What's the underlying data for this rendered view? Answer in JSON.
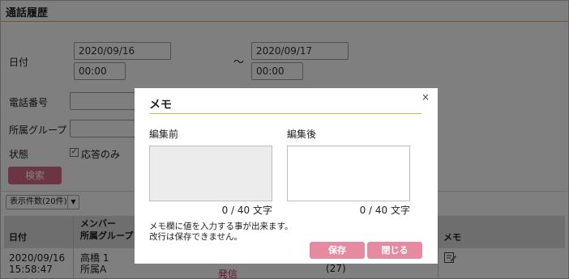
{
  "page": {
    "title": "通話履歴",
    "date_label": "日付",
    "date_from": "2020/09/16",
    "time_from": "00:00",
    "tilde": "～",
    "date_to": "2020/09/17",
    "time_to": "00:00",
    "phone_label": "電話番号",
    "group_label": "所属グループ",
    "status_label": "状態",
    "answered_only_label": "応答のみ",
    "answered_only_checked": true,
    "search_button": "検索",
    "count_dropdown": "表示件数(20件)",
    "caret": "▼"
  },
  "table": {
    "headers": {
      "date": "日付",
      "member_line1": "メンバー",
      "member_line2": "所属グループ",
      "memo": "メモ"
    },
    "rows": [
      {
        "date_line1": "2020/09/16",
        "date_line2": "15:58:47",
        "member_line1": "高橋 1",
        "member_line2": "所属A",
        "status": "発信",
        "count": "(27)",
        "memo_icon": "memo-edit-icon"
      }
    ]
  },
  "modal": {
    "title": "メモ",
    "close": "×",
    "before_label": "編集前",
    "after_label": "編集後",
    "before_count": "0 / 40 文字",
    "after_count": "0 / 40 文字",
    "note_line1": "メモ欄に値を入力する事が出来ます。",
    "note_line2": "改行は保存できません。",
    "save_button": "保存",
    "close_button": "閉じる"
  }
}
